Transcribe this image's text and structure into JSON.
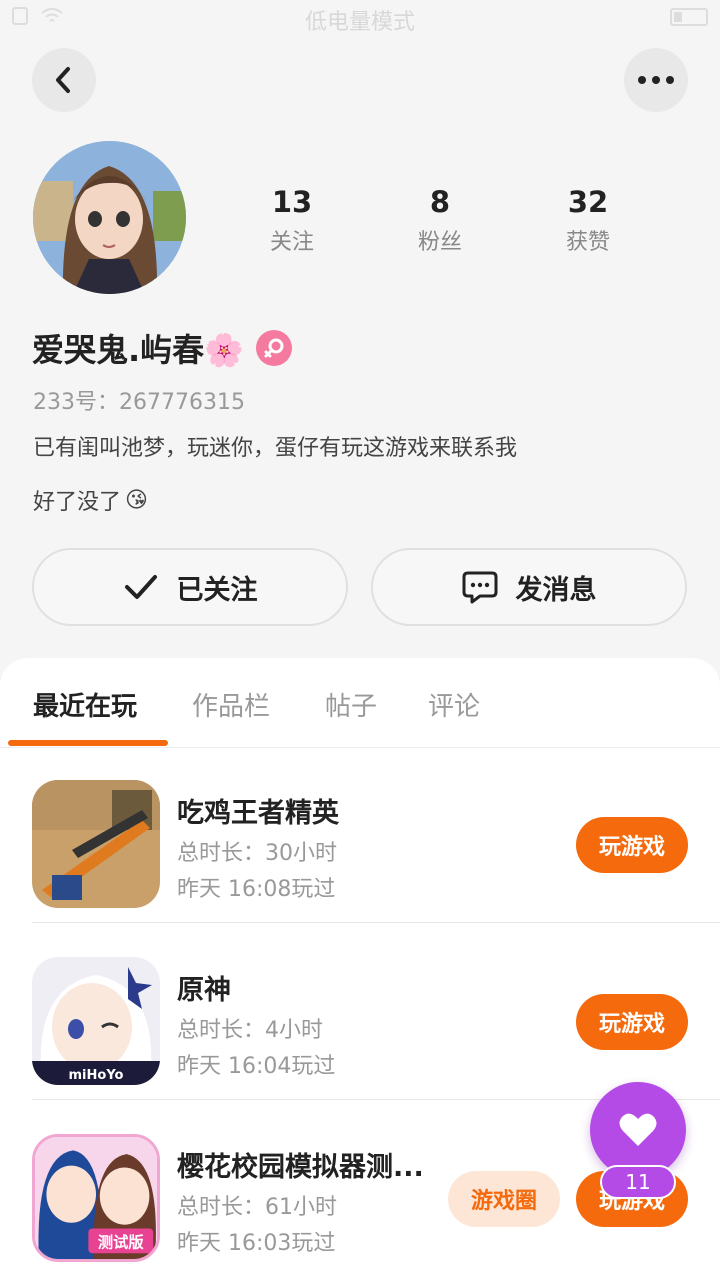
{
  "status_bar": {
    "center_text": "低电量模式"
  },
  "profile": {
    "stats": [
      {
        "value": "13",
        "label": "关注"
      },
      {
        "value": "8",
        "label": "粉丝"
      },
      {
        "value": "32",
        "label": "获赞"
      }
    ],
    "name": "爱哭鬼.屿春",
    "name_emoji": "🌸",
    "gender_symbol": "♀",
    "uid": "233号：267776315",
    "bio_line1": "已有闺叫池梦，玩迷你，蛋仔有玩这游戏来联系我",
    "bio_line2": "好了没了",
    "bio_emoji": "😘"
  },
  "actions": {
    "follow_label": "已关注",
    "message_label": "发消息"
  },
  "tabs": [
    {
      "label": "最近在玩",
      "active": true
    },
    {
      "label": "作品栏"
    },
    {
      "label": "帖子"
    },
    {
      "label": "评论"
    }
  ],
  "games": [
    {
      "title": "吃鸡王者精英",
      "duration": "总时长：30小时",
      "last_played": "昨天 16:08玩过",
      "play_label": "玩游戏"
    },
    {
      "title": "原神",
      "duration": "总时长：4小时",
      "last_played": "昨天 16:04玩过",
      "play_label": "玩游戏",
      "icon_caption": "miHoYo"
    },
    {
      "title": "樱花校园模拟器测...",
      "duration": "总时长：61小时",
      "last_played": "昨天 16:03玩过",
      "play_label": "玩游戏",
      "circle_label": "游戏圈",
      "icon_caption": "测试版"
    }
  ],
  "fab": {
    "count": "11"
  },
  "colors": {
    "accent": "#f56a0c",
    "fab": "#b44be6",
    "gender": "#f57aa0"
  }
}
